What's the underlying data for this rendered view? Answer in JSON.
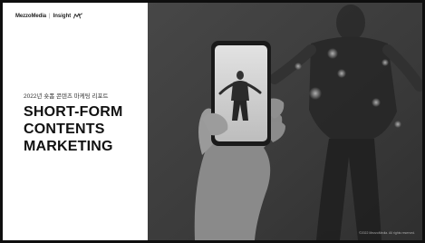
{
  "logo": {
    "brand": "MezzoMedia",
    "separator": "|",
    "insight": "Insight"
  },
  "report": {
    "subtitle": "2022년 숏폼 콘텐츠 마케팅 리포트",
    "title_lines": [
      "SHORT-FORM",
      "CONTENTS",
      "MARKETING"
    ]
  },
  "photo": {
    "subject": "hand-holding-smartphone-recording-dancer"
  },
  "footer": {
    "copyright": "©2022 MezzoMedia. All rights reserved."
  },
  "colors": {
    "left_panel": "#ffffff",
    "title_text": "#111111",
    "photo_tone": "#3a3a3a"
  }
}
